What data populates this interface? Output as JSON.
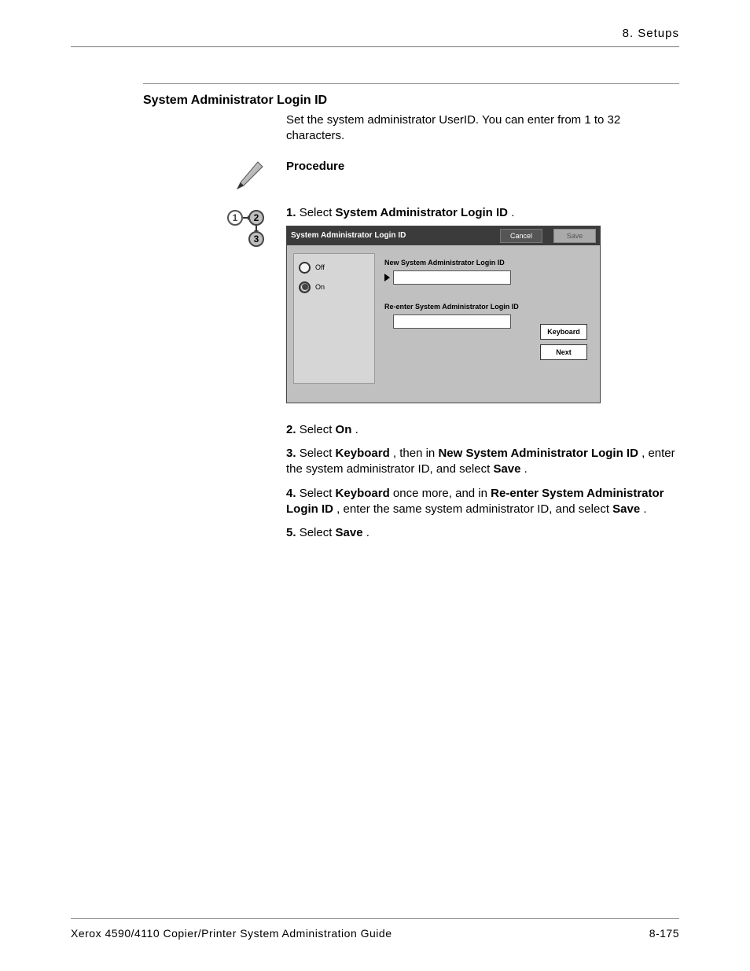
{
  "header": {
    "chapter": "8. Setups"
  },
  "section": {
    "title": "System Administrator Login ID",
    "intro": "Set the system administrator UserID. You can enter from 1 to 32 characters."
  },
  "procedure_label": "Procedure",
  "steps": {
    "s1": {
      "prefix": "1.",
      "t1": "Select ",
      "b1": "System Administrator Login ID",
      "t2": "."
    },
    "s2": {
      "prefix": "2.",
      "t1": "Select ",
      "b1": "On",
      "t2": "."
    },
    "s3": {
      "prefix": "3.",
      "t1": "Select ",
      "b1": "Keyboard",
      "t2": ", then in ",
      "b2": "New System Administrator Login ID",
      "t3": ", enter the system administrator ID, and select ",
      "b3": "Save",
      "t4": "."
    },
    "s4": {
      "prefix": "4.",
      "t1": "Select ",
      "b1": "Keyboard",
      "t2": " once more, and in ",
      "b2": "Re-enter System Administrator Login ID",
      "t3": ", enter the same system administrator ID, and select ",
      "b3": "Save",
      "t4": "."
    },
    "s5": {
      "prefix": "5.",
      "t1": "Select ",
      "b1": "Save",
      "t2": "."
    }
  },
  "shot": {
    "title": "System Administrator Login ID",
    "cancel": "Cancel",
    "save": "Save",
    "off": "Off",
    "on": "On",
    "new_label": "New System Administrator Login ID",
    "re_label": "Re-enter System Administrator Login ID",
    "keyboard": "Keyboard",
    "next": "Next"
  },
  "footer": {
    "left": "Xerox 4590/4110 Copier/Printer System Administration Guide",
    "right": "8-175"
  }
}
